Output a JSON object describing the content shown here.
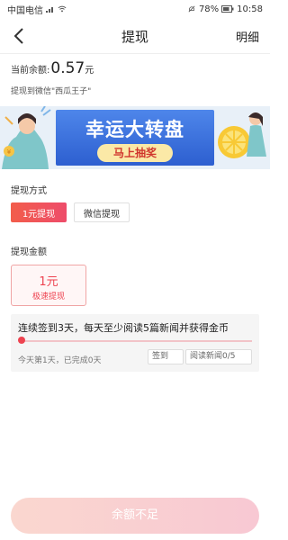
{
  "status_bar": {
    "carrier": "中国电信",
    "battery": "78%",
    "time": "10:58"
  },
  "nav": {
    "title": "提现",
    "detail_label": "明细"
  },
  "balance": {
    "label": "当前余额:",
    "value": "0.57",
    "unit": "元",
    "wechat_line": "提现到微信\"西瓜王子\""
  },
  "banner": {
    "title": "幸运大转盘",
    "button_label": "马上抽奖"
  },
  "withdraw_method": {
    "label": "提现方式",
    "options": [
      {
        "label": "1元提现",
        "selected": true
      },
      {
        "label": "微信提现",
        "selected": false
      }
    ]
  },
  "withdraw_amount": {
    "label": "提现金额",
    "amount": "1元",
    "sub_label": "极速提现"
  },
  "task": {
    "title": "连续签到3天，每天至少阅读5篇新闻并获得金币",
    "progress": 0,
    "status": "今天第1天，已完成0天",
    "tag_checkin": "签到",
    "tag_read": "阅读新闻0/5"
  },
  "bottom_button": {
    "label": "余额不足",
    "enabled": false
  },
  "colors": {
    "accent": "#ee4350",
    "banner_blue": "#3a6fe0",
    "button_disabled": "#f8cfd0"
  }
}
